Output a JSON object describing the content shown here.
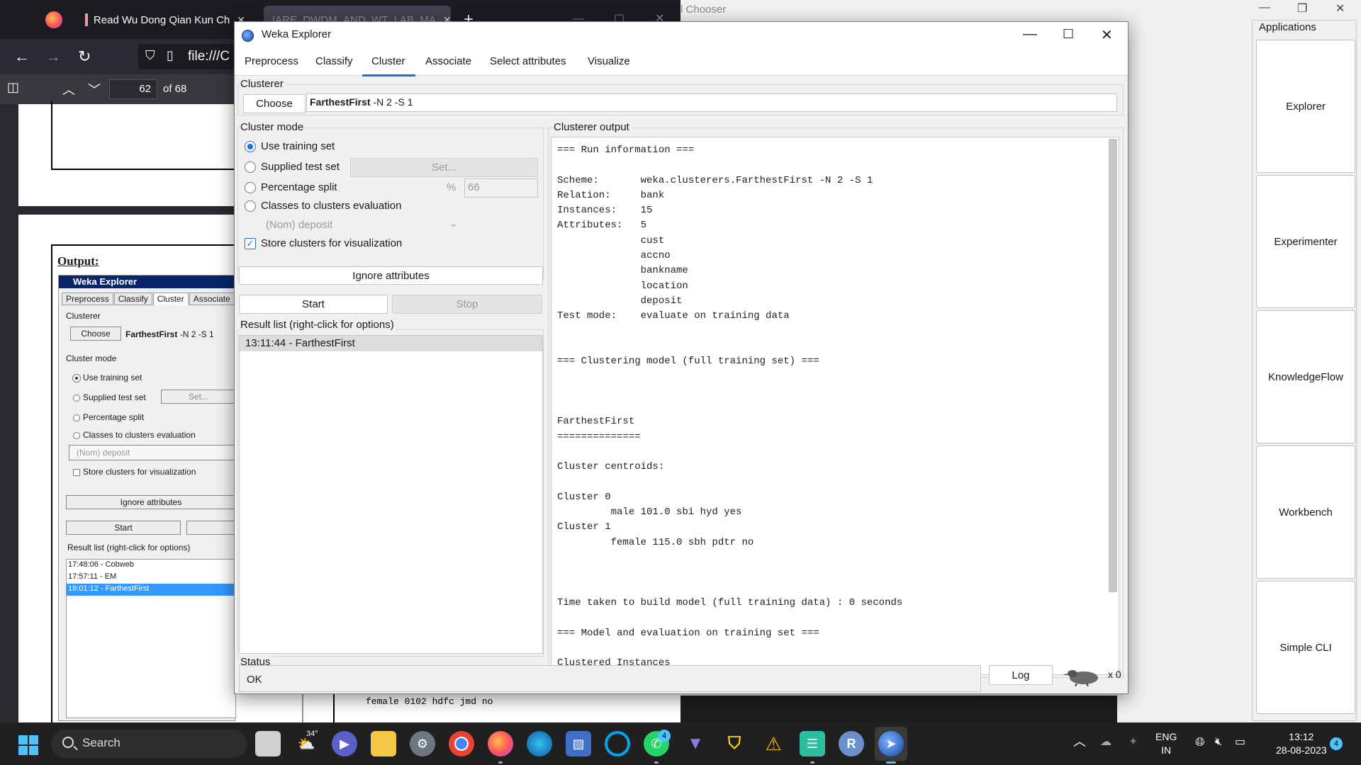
{
  "browser": {
    "tabs": [
      {
        "label": "Read Wu Dong Qian Kun Ch"
      },
      {
        "label": "IARE_DWDM_AND_WT_LAB_MA"
      }
    ],
    "url": "file:///C",
    "page_number": "62",
    "page_of": "of 68",
    "pdf": {
      "output_label": "Output:",
      "mini_window_title": "Weka Explorer",
      "mini_tabs": [
        "Preprocess",
        "Classify",
        "Cluster",
        "Associate"
      ],
      "clusterer_label": "Clusterer",
      "choose_label": "Choose",
      "clusterer_name": "FarthestFirst",
      "clusterer_args": "-N 2 -S 1",
      "cluster_mode_label": "Cluster mode",
      "modes": [
        "Use training set",
        "Supplied test set",
        "Percentage split",
        "Classes to clusters evaluation"
      ],
      "set_label": "Set...",
      "nom_label": "(Nom) deposit",
      "store_label": "Store clusters for visualization",
      "ignore_label": "Ignore attributes",
      "start_label": "Start",
      "result_label": "Result list (right-click for options)",
      "results": [
        "17:48:06 - Cobweb",
        "17:57:11 - EM",
        "18:01:12 - FarthestFirst"
      ],
      "bottom_text": "female 0102 hdfc jmd no"
    }
  },
  "chooser": {
    "title": "l Chooser",
    "group_label": "Applications",
    "apps": [
      "Explorer",
      "Experimenter",
      "KnowledgeFlow",
      "Workbench",
      "Simple CLI"
    ]
  },
  "weka": {
    "title": "Weka Explorer",
    "tabs": [
      "Preprocess",
      "Classify",
      "Cluster",
      "Associate",
      "Select attributes",
      "Visualize"
    ],
    "clusterer_legend": "Clusterer",
    "choose_label": "Choose",
    "clusterer_name": "FarthestFirst",
    "clusterer_args": "-N 2 -S 1",
    "cluster_mode_legend": "Cluster mode",
    "mode_training": "Use training set",
    "mode_supplied": "Supplied test set",
    "set_button": "Set...",
    "mode_percentage": "Percentage split",
    "percent_sign": "%",
    "percent_value": "66",
    "mode_classes": "Classes to clusters evaluation",
    "nom_deposit": "(Nom) deposit",
    "store_clusters": "Store clusters for visualization",
    "ignore_attributes": "Ignore attributes",
    "start_label": "Start",
    "stop_label": "Stop",
    "result_list_legend": "Result list (right-click for options)",
    "results": [
      "13:11:44 - FarthestFirst"
    ],
    "output_legend": "Clusterer output",
    "output_text": "=== Run information ===\n\nScheme:       weka.clusterers.FarthestFirst -N 2 -S 1\nRelation:     bank\nInstances:    15\nAttributes:   5\n              cust\n              accno\n              bankname\n              location\n              deposit\nTest mode:    evaluate on training data\n\n\n=== Clustering model (full training set) ===\n\n\n\nFarthestFirst\n==============\n\nCluster centroids:\n\nCluster 0\n         male 101.0 sbi hyd yes\nCluster 1\n         female 115.0 sbh pdtr no\n\n\n\nTime taken to build model (full training data) : 0 seconds\n\n=== Model and evaluation on training set ===\n\nClustered Instances",
    "status_legend": "Status",
    "status_text": "OK",
    "log_label": "Log",
    "x_count": "x 0"
  },
  "taskbar": {
    "search_label": "Search",
    "weather_temp": "34°",
    "whatsapp_badge": "4",
    "r_label": "R",
    "lang_line1": "ENG",
    "lang_line2": "IN",
    "time": "13:12",
    "date": "28-08-2023",
    "notif_count": "4"
  }
}
